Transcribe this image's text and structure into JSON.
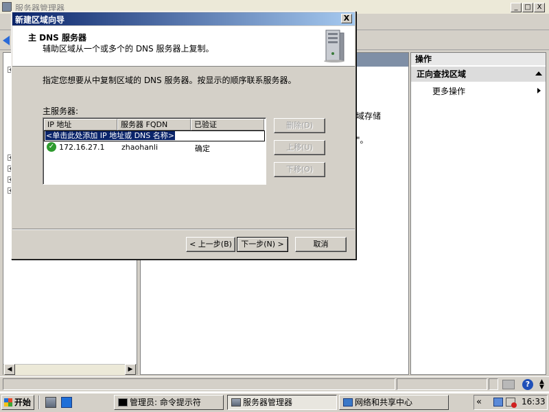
{
  "background_window": {
    "title": "服务器管理器",
    "title_buttons": {
      "minimize": "_",
      "maximize": "□",
      "close": "X"
    },
    "content_fragments": {
      "line1": "域存储",
      "line2": "\"。"
    },
    "actions_panel": {
      "header": "操作",
      "section_title": "正向查找区域",
      "more_actions": "更多操作"
    }
  },
  "wizard": {
    "title": "新建区域向导",
    "close_label": "X",
    "heading": "主 DNS 服务器",
    "subheading": "辅助区域从一个或多个的 DNS 服务器上复制。",
    "instruction": "指定您想要从中复制区域的 DNS 服务器。按显示的顺序联系服务器。",
    "master_servers_label": "主服务器:",
    "table": {
      "columns": [
        "IP 地址",
        "服务器 FQDN",
        "已验证"
      ],
      "edit_placeholder": "<单击此处添加 IP 地址或 DNS 名称>",
      "rows": [
        {
          "ip": "172.16.27.1",
          "fqdn": "zhaohanli",
          "validated": "确定"
        }
      ]
    },
    "side_buttons": {
      "delete": "删除(D)",
      "move_up": "上移(U)",
      "move_down": "下移(O)"
    },
    "footer_buttons": {
      "back": "< 上一步(B)",
      "next": "下一步(N) >",
      "cancel": "取消"
    }
  },
  "taskbar": {
    "start_label": "开始",
    "tasks": [
      {
        "label": "管理员: 命令提示符",
        "icon": "cmd-icon",
        "active": false
      },
      {
        "label": "服务器管理器",
        "icon": "server-manager-icon",
        "active": true
      },
      {
        "label": "网络和共享中心",
        "icon": "network-icon",
        "active": false
      }
    ],
    "tray_chevron": "«",
    "time": "16:33"
  },
  "colors": {
    "title_active_start": "#0a246a",
    "title_active_end": "#a6caf0",
    "face": "#d4d0c8",
    "selection": "#0a246a",
    "validated_ok": "#2e9a2e"
  }
}
